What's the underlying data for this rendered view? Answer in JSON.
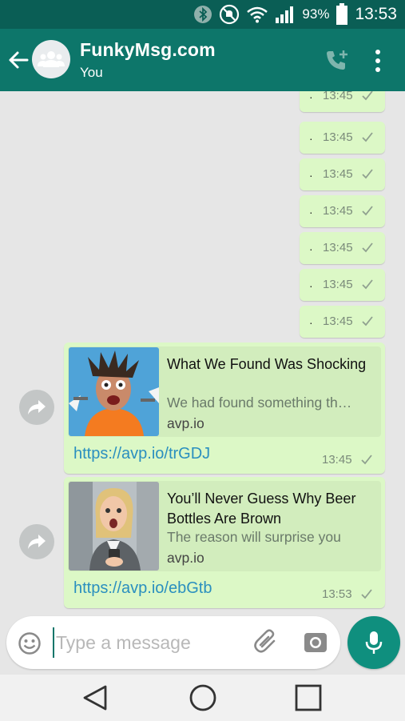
{
  "status_bar": {
    "battery_percent": "93%",
    "time": "13:53",
    "icons": [
      "bluetooth-icon",
      "mute-icon",
      "wifi-icon",
      "signal-icon",
      "battery-icon"
    ]
  },
  "header": {
    "title": "FunkyMsg.com",
    "subtitle": "You"
  },
  "messages": {
    "small": [
      {
        "dot": "·",
        "time": "13:45"
      },
      {
        "dot": "·",
        "time": "13:45"
      },
      {
        "dot": "·",
        "time": "13:45"
      },
      {
        "dot": "·",
        "time": "13:45"
      },
      {
        "dot": "·",
        "time": "13:45"
      },
      {
        "dot": "·",
        "time": "13:45"
      },
      {
        "dot": "·",
        "time": "13:45"
      }
    ],
    "links": [
      {
        "title": "What We Found Was Shocking",
        "description": "We had found something th…",
        "domain": "avp.io",
        "url": "https://avp.io/trGDJ",
        "time": "13:45"
      },
      {
        "title": "You’ll Never Guess Why Beer Bottles Are Brown",
        "description": "The reason will surprise you",
        "domain": "avp.io",
        "url": "https://avp.io/ebGtb",
        "time": "13:53"
      }
    ]
  },
  "composer": {
    "placeholder": "Type a message"
  },
  "colors": {
    "header": "#0d766a",
    "status_bar": "#0a5e55",
    "bubble": "#dcf8c6",
    "link": "#2a8fbf",
    "mic": "#0f8f7e"
  }
}
